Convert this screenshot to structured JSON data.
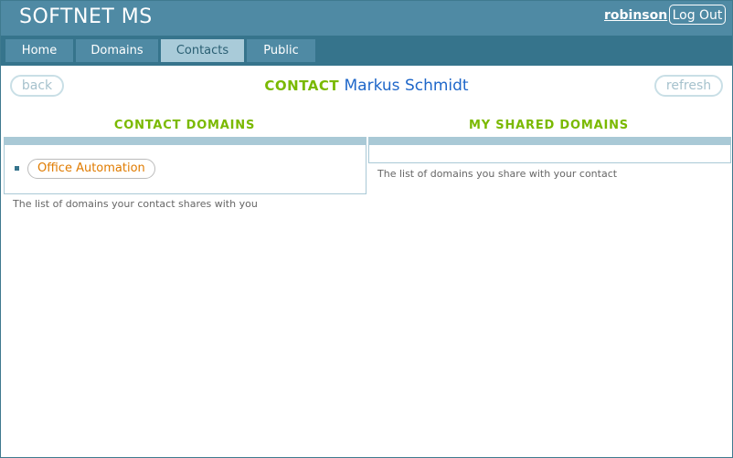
{
  "header": {
    "app_title": "SOFTNET MS",
    "username": "robinson",
    "logout_label": "Log Out"
  },
  "nav": {
    "tabs": [
      {
        "label": "Home"
      },
      {
        "label": "Domains"
      },
      {
        "label": "Contacts",
        "active": true
      },
      {
        "label": "Public"
      }
    ]
  },
  "toolbar": {
    "back_label": "back",
    "refresh_label": "refresh"
  },
  "page": {
    "heading_label": "CONTACT",
    "contact_name": "Markus Schmidt"
  },
  "contact_domains": {
    "title": "CONTACT DOMAINS",
    "items": [
      "Office Automation"
    ],
    "hint": "The list of domains your contact shares with you"
  },
  "shared_domains": {
    "title": "MY SHARED DOMAINS",
    "items": [],
    "hint": "The list of domains you share with your contact"
  },
  "colors": {
    "header_bg": "#4f8aa4",
    "nav_bg": "#36748c",
    "active_tab": "#a9cbd9",
    "accent_green": "#7ab900",
    "name_blue": "#1f67c9",
    "chip_orange": "#e07b00"
  }
}
